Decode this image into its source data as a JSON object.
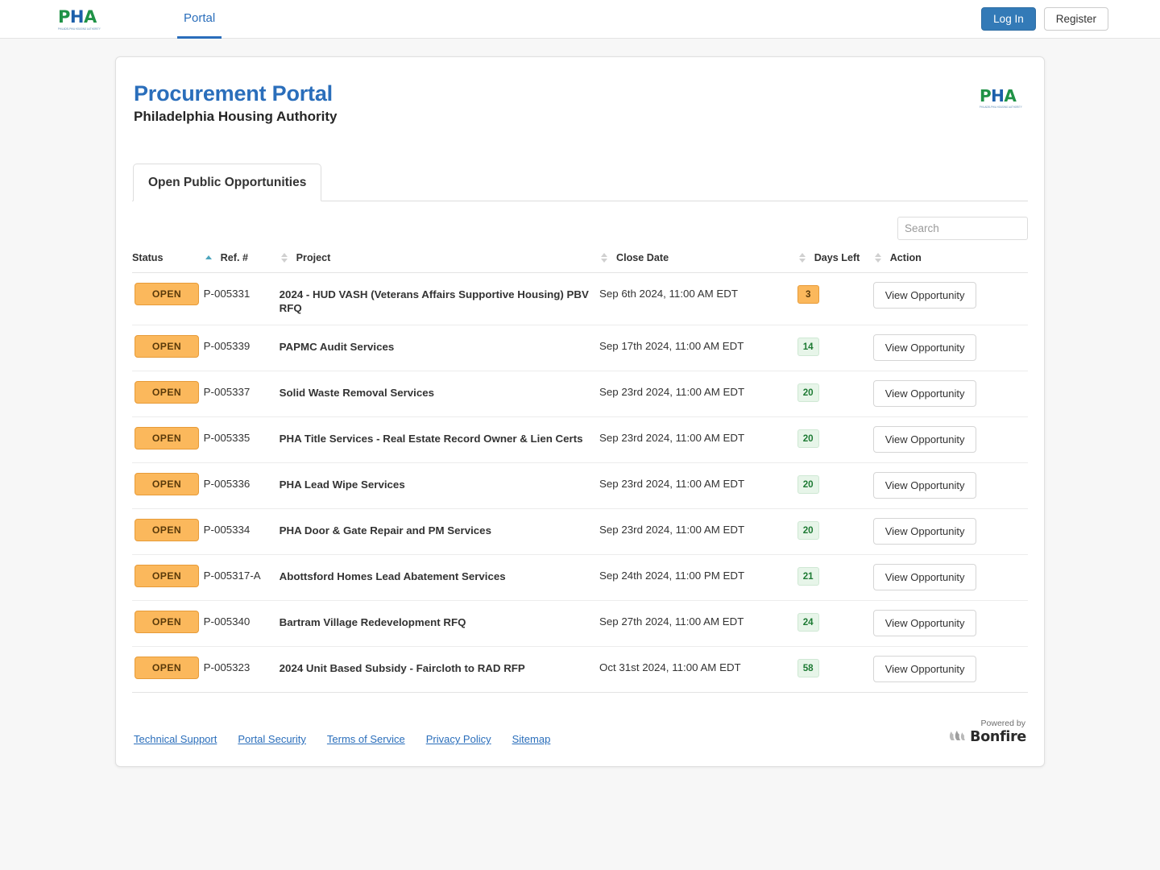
{
  "navbar": {
    "logo": {
      "p": "P",
      "h": "H",
      "a": "A",
      "tagline": "PHILADELPHIA HOUSING AUTHORITY"
    },
    "tabs": [
      {
        "label": "Portal",
        "active": true
      }
    ],
    "login_label": "Log In",
    "register_label": "Register"
  },
  "header": {
    "title": "Procurement Portal",
    "subtitle": "Philadelphia Housing Authority",
    "logo": {
      "p": "P",
      "h": "H",
      "a": "A",
      "tagline": "PHILADELPHIA HOUSING AUTHORITY"
    }
  },
  "tabs": [
    {
      "label": "Open Public Opportunities",
      "active": true
    }
  ],
  "search": {
    "value": "",
    "placeholder": "Search"
  },
  "table": {
    "columns": [
      {
        "key": "status",
        "label": "Status",
        "sortable": true,
        "sort": "asc"
      },
      {
        "key": "ref",
        "label": "Ref. #",
        "sortable": true,
        "sort": "none"
      },
      {
        "key": "project",
        "label": "Project",
        "sortable": true,
        "sort": "none"
      },
      {
        "key": "close_date",
        "label": "Close Date",
        "sortable": true,
        "sort": "none"
      },
      {
        "key": "days_left",
        "label": "Days Left",
        "sortable": true,
        "sort": "none"
      },
      {
        "key": "action",
        "label": "Action",
        "sortable": false,
        "sort": "none"
      }
    ],
    "action_label": "View Opportunity",
    "rows": [
      {
        "status": "OPEN",
        "ref": "P-005331",
        "project": "2024 - HUD VASH (Veterans Affairs Supportive Housing) PBV RFQ",
        "close_date": "Sep 6th 2024, 11:00 AM EDT",
        "days_left": "3",
        "days_tone": "orange"
      },
      {
        "status": "OPEN",
        "ref": "P-005339",
        "project": "PAPMC Audit Services",
        "close_date": "Sep 17th 2024, 11:00 AM EDT",
        "days_left": "14",
        "days_tone": "green"
      },
      {
        "status": "OPEN",
        "ref": "P-005337",
        "project": "Solid Waste Removal Services",
        "close_date": "Sep 23rd 2024, 11:00 AM EDT",
        "days_left": "20",
        "days_tone": "green"
      },
      {
        "status": "OPEN",
        "ref": "P-005335",
        "project": "PHA Title Services - Real Estate Record Owner & Lien Certs",
        "close_date": "Sep 23rd 2024, 11:00 AM EDT",
        "days_left": "20",
        "days_tone": "green"
      },
      {
        "status": "OPEN",
        "ref": "P-005336",
        "project": "PHA Lead Wipe Services",
        "close_date": "Sep 23rd 2024, 11:00 AM EDT",
        "days_left": "20",
        "days_tone": "green"
      },
      {
        "status": "OPEN",
        "ref": "P-005334",
        "project": "PHA Door & Gate Repair and PM Services",
        "close_date": "Sep 23rd 2024, 11:00 AM EDT",
        "days_left": "20",
        "days_tone": "green"
      },
      {
        "status": "OPEN",
        "ref": "P-005317-A",
        "project": "Abottsford Homes Lead Abatement Services",
        "close_date": "Sep 24th 2024, 11:00 PM EDT",
        "days_left": "21",
        "days_tone": "green"
      },
      {
        "status": "OPEN",
        "ref": "P-005340",
        "project": "Bartram Village Redevelopment RFQ",
        "close_date": "Sep 27th 2024, 11:00 AM EDT",
        "days_left": "24",
        "days_tone": "green"
      },
      {
        "status": "OPEN",
        "ref": "P-005323",
        "project": "2024 Unit Based Subsidy - Faircloth to RAD RFP",
        "close_date": "Oct 31st 2024, 11:00 AM EDT",
        "days_left": "58",
        "days_tone": "green"
      }
    ]
  },
  "footer": {
    "links": [
      {
        "label": "Technical Support"
      },
      {
        "label": "Portal Security"
      },
      {
        "label": "Terms of Service"
      },
      {
        "label": "Privacy Policy"
      },
      {
        "label": "Sitemap"
      }
    ],
    "powered_by": "Powered by",
    "brand": "Bonfire"
  },
  "colors": {
    "accent_blue": "#2a6ebb",
    "open_badge": "#fbb85c",
    "days_green_bg": "#e7f5e9",
    "days_green_text": "#1d7a33",
    "sort_active": "#4ca5bd",
    "logo_green": "#1f9246",
    "logo_blue": "#1b5faa"
  }
}
